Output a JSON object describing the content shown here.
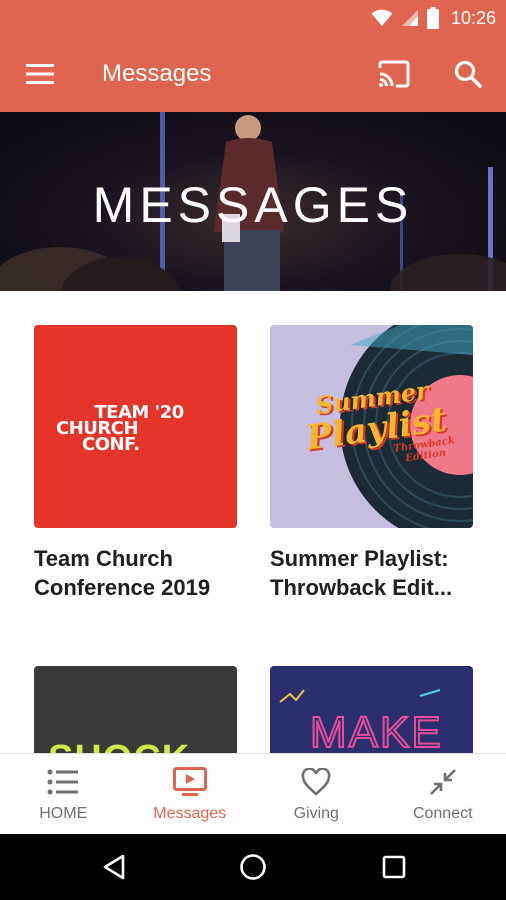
{
  "status_bar": {
    "time": "10:26"
  },
  "app_bar": {
    "title": "Messages"
  },
  "hero": {
    "title": "MESSAGES"
  },
  "cards": [
    {
      "title": "Team Church Conference 2019",
      "art_text": [
        "TEAM '20",
        "CHURCH",
        "CONF."
      ],
      "art_bg": "#e5342a"
    },
    {
      "title": "Summer Playlist: Throwback Edit...",
      "art_text": [
        "Summer",
        "Playlist",
        "Throwback Edition"
      ],
      "art_bg": "#c6bede"
    },
    {
      "title": "",
      "art_text": [
        "SHOCK"
      ],
      "art_bg": "#3a3a3a"
    },
    {
      "title": "",
      "art_text": [
        "MAKE"
      ],
      "art_bg": "#2b2f6e"
    }
  ],
  "bottom_nav": {
    "items": [
      {
        "label": "HOME",
        "icon": "list-icon",
        "active": false
      },
      {
        "label": "Messages",
        "icon": "tv-play-icon",
        "active": true
      },
      {
        "label": "Giving",
        "icon": "heart-icon",
        "active": false
      },
      {
        "label": "Connect",
        "icon": "connect-arrows-icon",
        "active": false
      }
    ]
  },
  "colors": {
    "brand": "#e06550",
    "text_dark": "#202020",
    "nav_inactive": "#707070"
  }
}
